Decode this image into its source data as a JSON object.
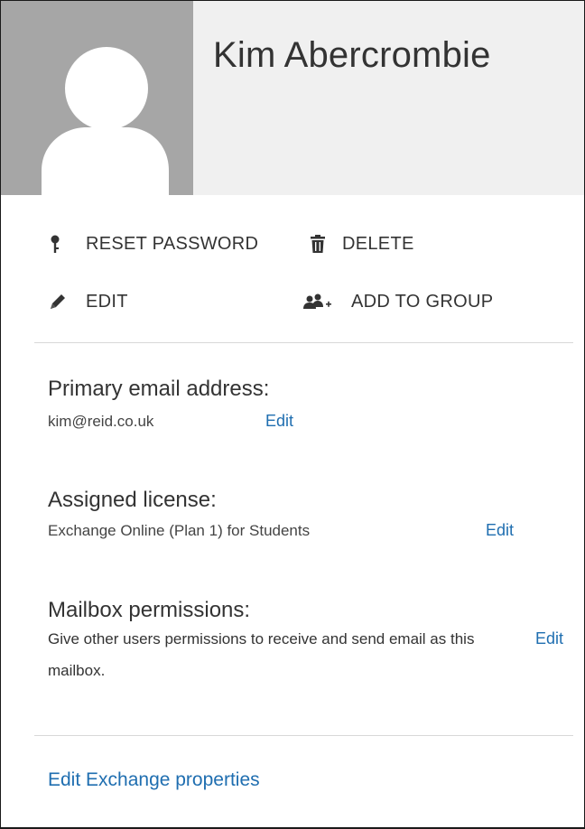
{
  "user": {
    "name": "Kim Abercrombie"
  },
  "actions": {
    "reset_password": {
      "label": "RESET PASSWORD",
      "icon": "key-icon"
    },
    "delete": {
      "label": "DELETE",
      "icon": "trash-icon"
    },
    "edit": {
      "label": "EDIT",
      "icon": "pencil-icon"
    },
    "add_to_group": {
      "label": "ADD TO GROUP",
      "icon": "add-group-icon"
    }
  },
  "primary_email": {
    "title": "Primary email address:",
    "value": "kim@reid.co.uk",
    "edit_label": "Edit"
  },
  "license": {
    "title": "Assigned license:",
    "value": "Exchange Online (Plan 1) for Students",
    "edit_label": "Edit"
  },
  "mailbox_permissions": {
    "title": "Mailbox permissions:",
    "description": "Give other users permissions to receive and send email as this mailbox.",
    "edit_label": "Edit"
  },
  "footer": {
    "exchange_link": "Edit Exchange properties"
  },
  "colors": {
    "accent": "#1f6eb0",
    "avatar_bg": "#a6a6a6",
    "header_bg": "#f0f0f0"
  }
}
